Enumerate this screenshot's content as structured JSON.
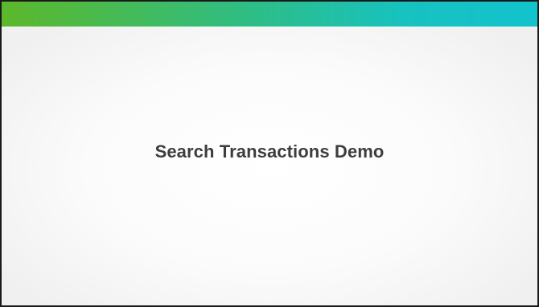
{
  "slide": {
    "title": "Search Transactions Demo"
  },
  "colors": {
    "accent_start": "#5cb82a",
    "accent_end": "#12c3cd",
    "title_text": "#3d3d3d",
    "border": "#1a1a1a"
  }
}
